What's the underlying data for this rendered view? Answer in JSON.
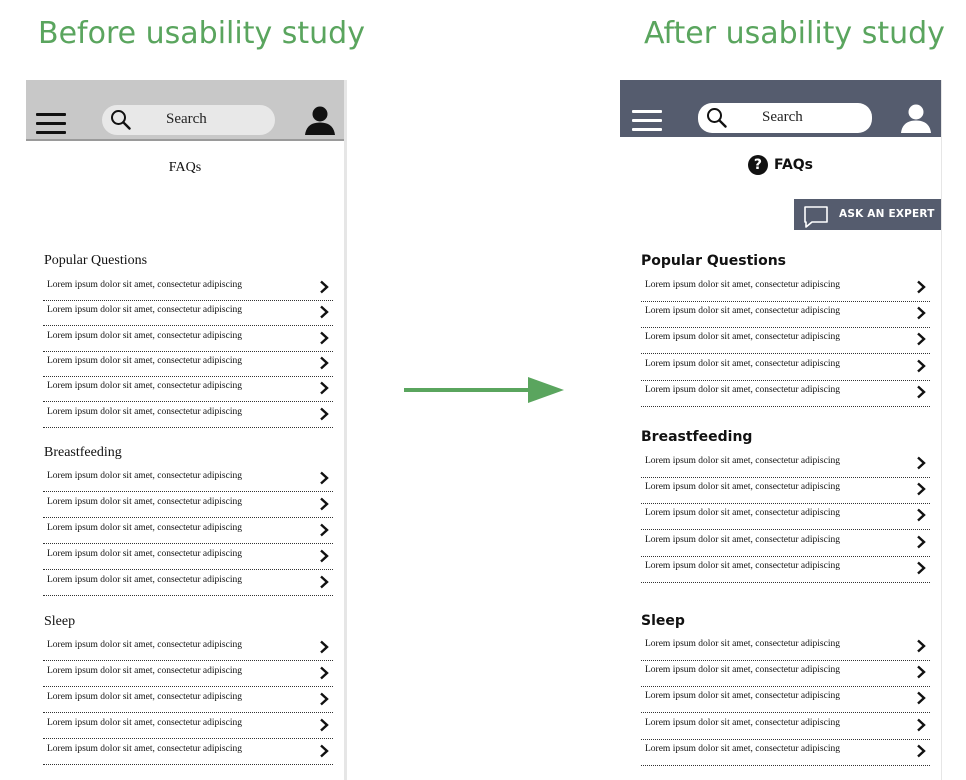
{
  "headings": {
    "before": "Before usability study",
    "after": "After usability study"
  },
  "colors": {
    "heading_green": "#5aa55e",
    "before_topbar": "#c8c8c8",
    "after_topbar": "#555c6e"
  },
  "before": {
    "search_label": "Search",
    "title": "FAQs",
    "sections": [
      {
        "title": "Popular Questions",
        "items": [
          "Lorem ipsum dolor sit amet, consectetur adipiscing",
          "Lorem ipsum dolor sit amet, consectetur adipiscing",
          "Lorem ipsum dolor sit amet, consectetur adipiscing",
          "Lorem ipsum dolor sit amet, consectetur adipiscing",
          "Lorem ipsum dolor sit amet, consectetur adipiscing",
          "Lorem ipsum dolor sit amet, consectetur adipiscing"
        ]
      },
      {
        "title": "Breastfeeding",
        "items": [
          "Lorem ipsum dolor sit amet, consectetur adipiscing",
          "Lorem ipsum dolor sit amet, consectetur adipiscing",
          "Lorem ipsum dolor sit amet, consectetur adipiscing",
          "Lorem ipsum dolor sit amet, consectetur adipiscing",
          "Lorem ipsum dolor sit amet, consectetur adipiscing"
        ]
      },
      {
        "title": "Sleep",
        "items": [
          "Lorem ipsum dolor sit amet, consectetur adipiscing",
          "Lorem ipsum dolor sit amet, consectetur adipiscing",
          "Lorem ipsum dolor sit amet, consectetur adipiscing",
          "Lorem ipsum dolor sit amet, consectetur adipiscing",
          "Lorem ipsum dolor sit amet, consectetur adipiscing"
        ]
      }
    ]
  },
  "after": {
    "search_label": "Search",
    "title": "FAQs",
    "ask_expert_label": "ASK AN EXPERT",
    "sections": [
      {
        "title": "Popular Questions",
        "items": [
          "Lorem ipsum dolor sit amet, consectetur adipiscing",
          "Lorem ipsum dolor sit amet, consectetur adipiscing",
          "Lorem ipsum dolor sit amet, consectetur adipiscing",
          "Lorem ipsum dolor sit amet, consectetur adipiscing",
          "Lorem ipsum dolor sit amet, consectetur adipiscing"
        ]
      },
      {
        "title": "Breastfeeding",
        "items": [
          "Lorem ipsum dolor sit amet, consectetur adipiscing",
          "Lorem ipsum dolor sit amet, consectetur adipiscing",
          "Lorem ipsum dolor sit amet, consectetur adipiscing",
          "Lorem ipsum dolor sit amet, consectetur adipiscing",
          "Lorem ipsum dolor sit amet, consectetur adipiscing"
        ]
      },
      {
        "title": "Sleep",
        "items": [
          "Lorem ipsum dolor sit amet, consectetur adipiscing",
          "Lorem ipsum dolor sit amet, consectetur adipiscing",
          "Lorem ipsum dolor sit amet, consectetur adipiscing",
          "Lorem ipsum dolor sit amet, consectetur adipiscing",
          "Lorem ipsum dolor sit amet, consectetur adipiscing"
        ]
      }
    ]
  }
}
